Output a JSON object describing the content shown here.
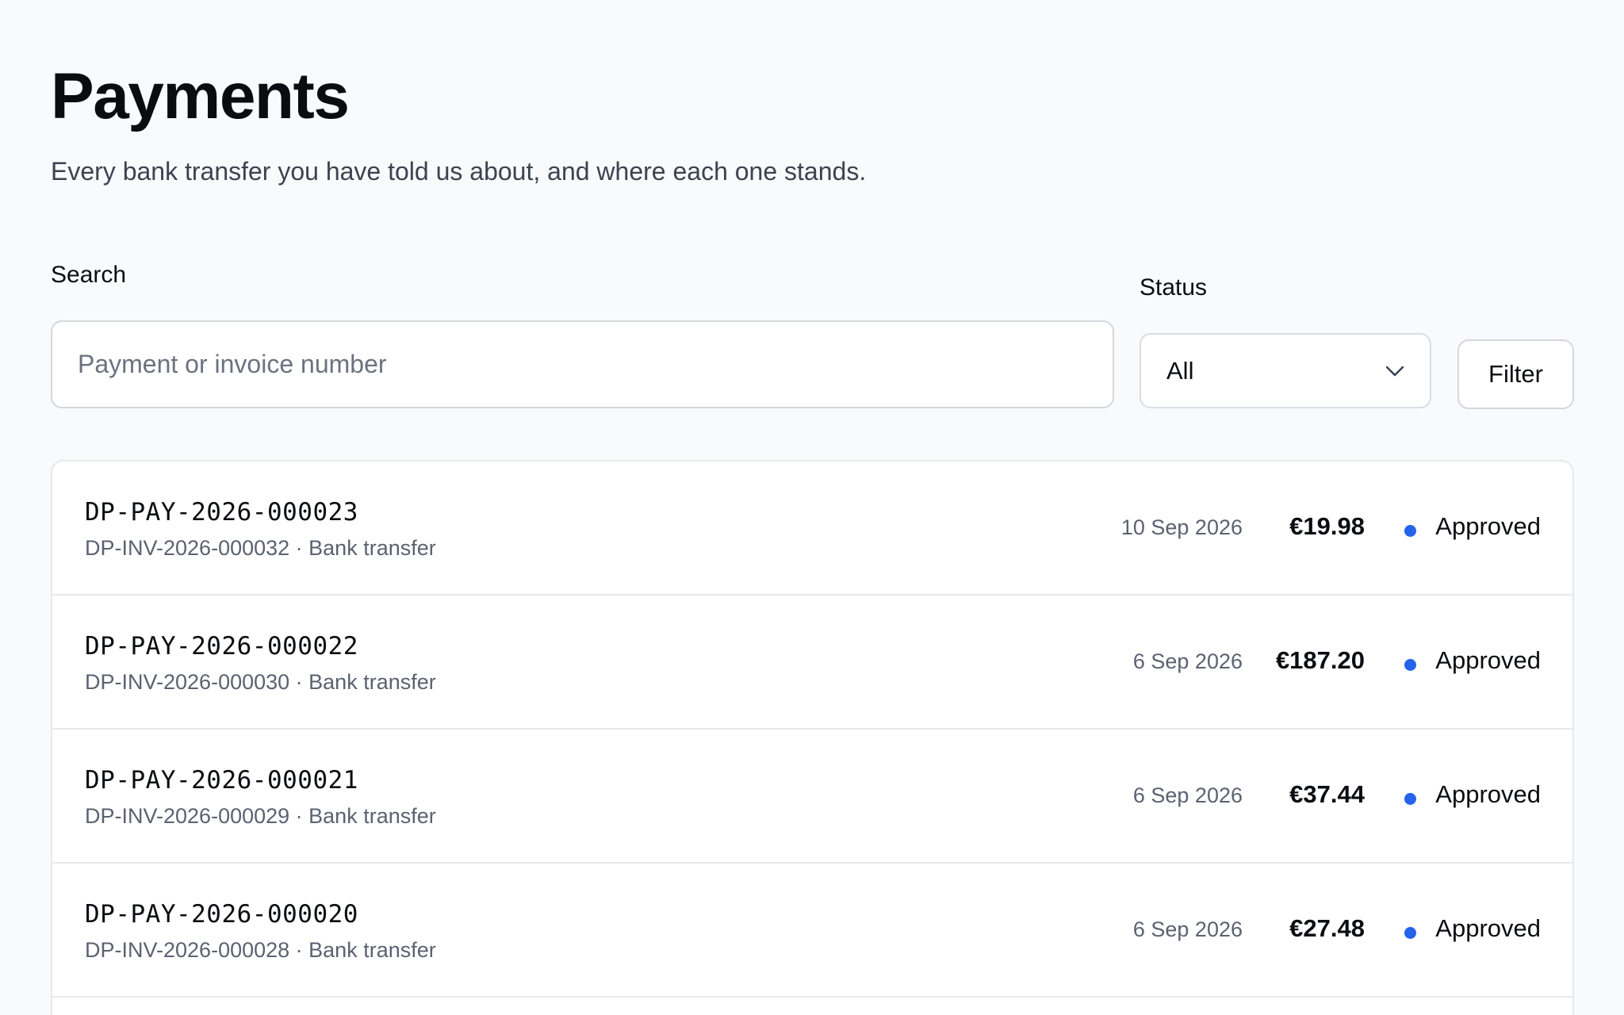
{
  "header": {
    "title": "Payments",
    "subtitle": "Every bank transfer you have told us about, and where each one stands."
  },
  "filters": {
    "search_label": "Search",
    "search_placeholder": "Payment or invoice number",
    "search_value": "",
    "status_label": "Status",
    "status_value": "All",
    "filter_button": "Filter"
  },
  "colors": {
    "status_approved": "#2563eb"
  },
  "payments": [
    {
      "id": "DP-PAY-2026-000023",
      "meta": "DP-INV-2026-000032 · Bank transfer",
      "date": "10 Sep 2026",
      "amount": "€19.98",
      "status": "Approved"
    },
    {
      "id": "DP-PAY-2026-000022",
      "meta": "DP-INV-2026-000030 · Bank transfer",
      "date": "6 Sep 2026",
      "amount": "€187.20",
      "status": "Approved"
    },
    {
      "id": "DP-PAY-2026-000021",
      "meta": "DP-INV-2026-000029 · Bank transfer",
      "date": "6 Sep 2026",
      "amount": "€37.44",
      "status": "Approved"
    },
    {
      "id": "DP-PAY-2026-000020",
      "meta": "DP-INV-2026-000028 · Bank transfer",
      "date": "6 Sep 2026",
      "amount": "€27.48",
      "status": "Approved"
    }
  ]
}
